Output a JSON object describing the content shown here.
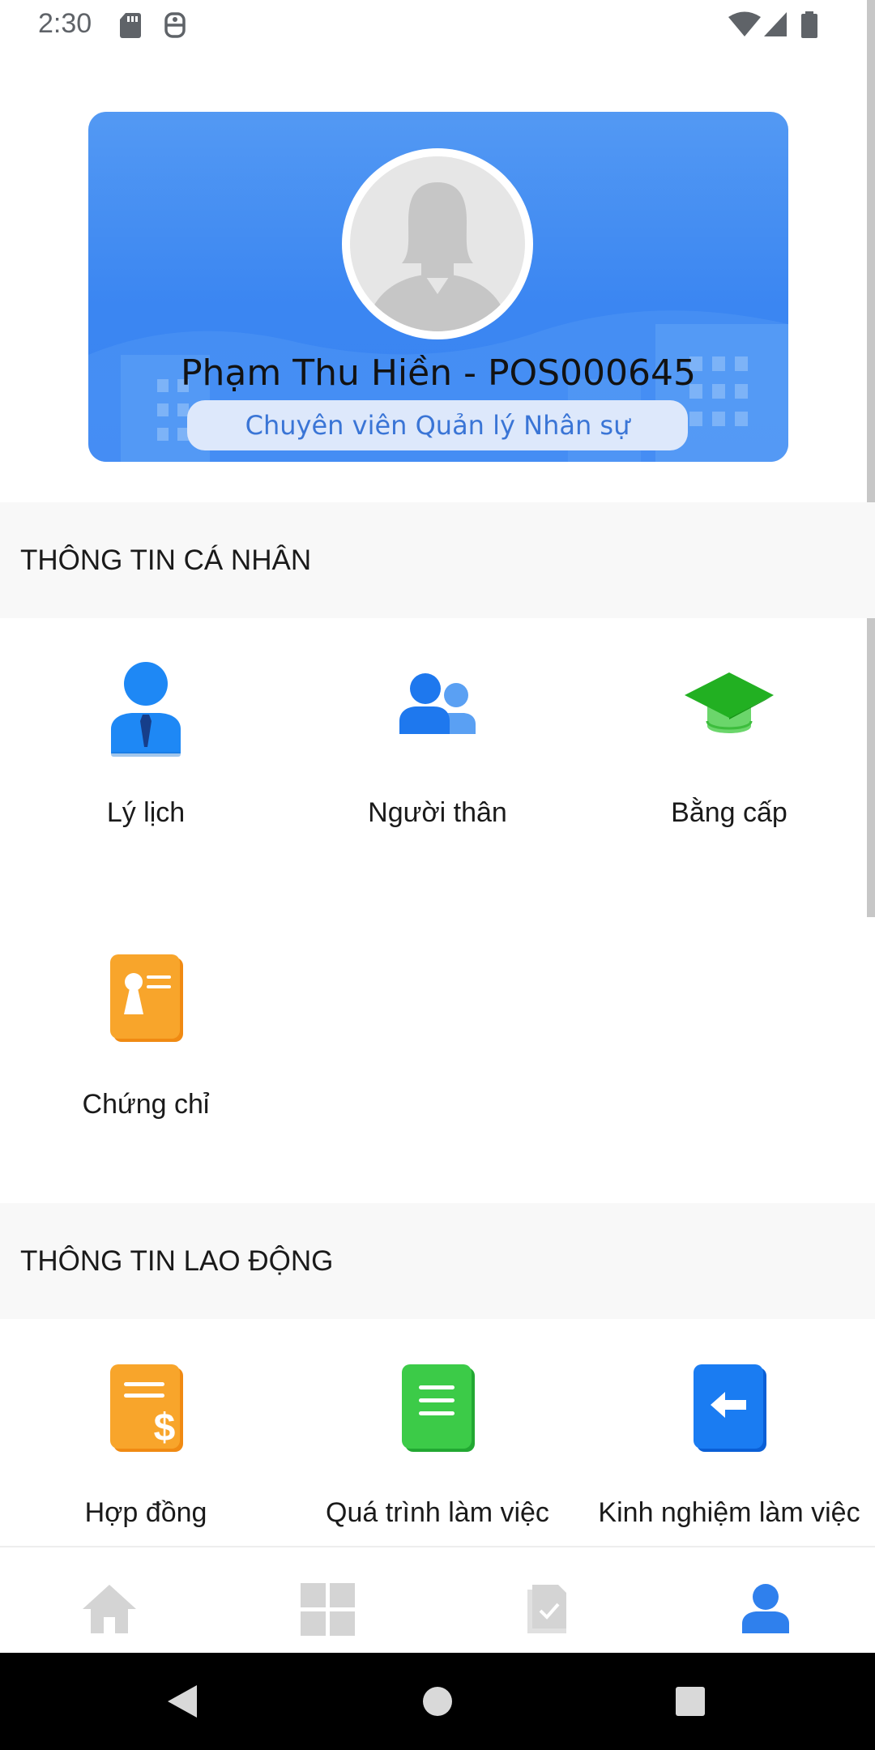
{
  "status_bar": {
    "time": "2:30",
    "icons": [
      "sd-card-icon",
      "sim-card-icon",
      "wifi-icon",
      "cell-signal-icon",
      "battery-icon"
    ]
  },
  "profile": {
    "name": "Phạm Thu Hiền - POS000645",
    "role": "Chuyên viên Quản lý Nhân sự",
    "avatar_icon": "person-placeholder-icon"
  },
  "sections": [
    {
      "title": "THÔNG TIN CÁ NHÂN",
      "items": [
        {
          "label": "Lý lịch",
          "icon": "resume-person-icon"
        },
        {
          "label": "Người thân",
          "icon": "family-icon"
        },
        {
          "label": "Bằng cấp",
          "icon": "graduation-cap-icon"
        },
        {
          "label": "Chứng chỉ",
          "icon": "certificate-icon"
        }
      ]
    },
    {
      "title": "THÔNG TIN LAO ĐỘNG",
      "items": [
        {
          "label": "Hợp đồng",
          "icon": "contract-icon"
        },
        {
          "label": "Quá trình làm việc",
          "icon": "work-history-icon"
        },
        {
          "label": "Kinh nghiệm làm việc",
          "icon": "experience-icon"
        }
      ]
    }
  ],
  "bottom_nav": [
    {
      "name": "home",
      "icon": "home-icon",
      "active": false
    },
    {
      "name": "apps",
      "icon": "grid-icon",
      "active": false
    },
    {
      "name": "documents",
      "icon": "document-check-icon",
      "active": false
    },
    {
      "name": "profile",
      "icon": "profile-icon",
      "active": true
    }
  ],
  "colors": {
    "card_blue": "#3b86f2",
    "active_nav": "#2f80ed",
    "inactive_nav": "#d4d4d4",
    "section_bg": "#f8f8f8"
  }
}
